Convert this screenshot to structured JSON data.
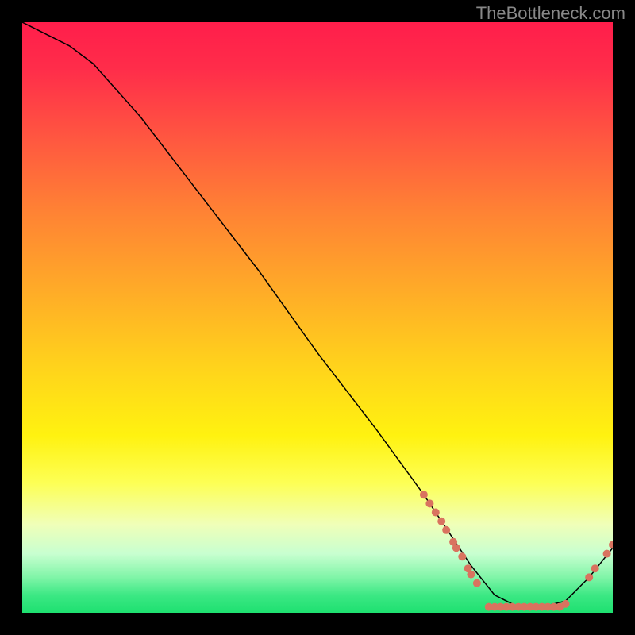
{
  "watermark": "TheBottleneck.com",
  "chart_data": {
    "type": "line",
    "title": "",
    "xlabel": "",
    "ylabel": "",
    "xlim": [
      0,
      100
    ],
    "ylim": [
      0,
      100
    ],
    "grid": false,
    "series": [
      {
        "name": "curve",
        "x": [
          0,
          4,
          8,
          12,
          20,
          30,
          40,
          50,
          60,
          68,
          72,
          76,
          80,
          84,
          88,
          92,
          96,
          100
        ],
        "y": [
          100,
          98,
          96,
          93,
          84,
          71,
          58,
          44,
          31,
          20,
          14,
          8,
          3,
          1,
          1,
          2,
          6,
          11
        ]
      }
    ],
    "scatter": [
      {
        "name": "dots",
        "points": [
          {
            "x": 68.0,
            "y": 20.0
          },
          {
            "x": 69.0,
            "y": 18.5
          },
          {
            "x": 70.0,
            "y": 17.0
          },
          {
            "x": 71.0,
            "y": 15.5
          },
          {
            "x": 71.8,
            "y": 14.0
          },
          {
            "x": 73.0,
            "y": 12.0
          },
          {
            "x": 73.5,
            "y": 11.0
          },
          {
            "x": 74.5,
            "y": 9.5
          },
          {
            "x": 75.5,
            "y": 7.5
          },
          {
            "x": 76.0,
            "y": 6.5
          },
          {
            "x": 77.0,
            "y": 5.0
          },
          {
            "x": 79.0,
            "y": 1.0
          },
          {
            "x": 80.0,
            "y": 1.0
          },
          {
            "x": 81.0,
            "y": 1.0
          },
          {
            "x": 82.0,
            "y": 1.0
          },
          {
            "x": 83.0,
            "y": 1.0
          },
          {
            "x": 84.0,
            "y": 1.0
          },
          {
            "x": 85.0,
            "y": 1.0
          },
          {
            "x": 86.0,
            "y": 1.0
          },
          {
            "x": 87.0,
            "y": 1.0
          },
          {
            "x": 88.0,
            "y": 1.0
          },
          {
            "x": 89.0,
            "y": 1.0
          },
          {
            "x": 90.0,
            "y": 1.0
          },
          {
            "x": 91.0,
            "y": 1.0
          },
          {
            "x": 92.0,
            "y": 1.5
          },
          {
            "x": 96.0,
            "y": 6.0
          },
          {
            "x": 97.0,
            "y": 7.5
          },
          {
            "x": 99.0,
            "y": 10.0
          },
          {
            "x": 100.0,
            "y": 11.5
          }
        ]
      }
    ],
    "background_gradient": [
      "#ff1e4b",
      "#ff5840",
      "#ffaa28",
      "#fff210",
      "#f0ffb8",
      "#3ce884",
      "#1ee070"
    ]
  }
}
